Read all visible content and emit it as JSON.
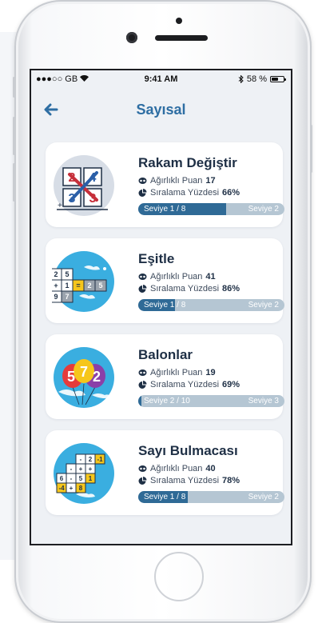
{
  "status_bar": {
    "carrier": "●●●○○ GB",
    "time": "9:41 AM",
    "battery_text": "58 %",
    "battery_level": 0.58
  },
  "nav": {
    "back_icon": "arrow-left-icon",
    "title": "Sayısal"
  },
  "labels": {
    "weighted_points": "Ağırlıklı Puan",
    "rank_percent": "Sıralama Yüzdesi"
  },
  "games": [
    {
      "title": "Rakam Değiştir",
      "points": "17",
      "rank": "66%",
      "level_current": "Seviye 1 / 8",
      "level_next": "Seviye 2",
      "progress": 0.6,
      "icon": "number-swap-icon"
    },
    {
      "title": "Eşitle",
      "points": "41",
      "rank": "86%",
      "level_current": "Seviye 1 / 8",
      "level_next": "Seviye 2",
      "progress": 0.25,
      "icon": "number-grid-icon"
    },
    {
      "title": "Balonlar",
      "points": "19",
      "rank": "69%",
      "level_current": "Seviye 2 / 10",
      "level_next": "Seviye 3",
      "progress": 0.02,
      "icon": "balloons-icon"
    },
    {
      "title": "Sayı Bulmacası",
      "points": "40",
      "rank": "78%",
      "level_current": "Seviye 1 / 8",
      "level_next": "Seviye 2",
      "progress": 0.34,
      "icon": "number-puzzle-icon"
    }
  ],
  "colors": {
    "accent": "#2e6ea3",
    "progress_fill": "#2f6a96",
    "progress_track": "#b5c6d3",
    "screen_bg": "#eef1f5"
  }
}
